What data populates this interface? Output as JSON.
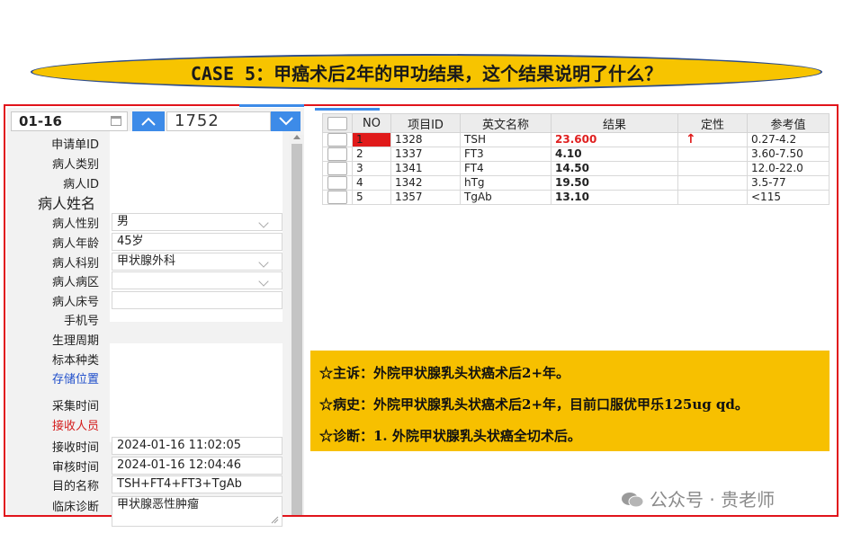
{
  "title": "CASE 5：甲癌术后2年的甲功结果，这个结果说明了什么？",
  "left": {
    "date": "01-16",
    "sample_no": "1752",
    "fields": [
      {
        "label": "申请单ID",
        "value": ""
      },
      {
        "label": "病人类别",
        "value": ""
      },
      {
        "label": "病人ID",
        "value": ""
      },
      {
        "label": "病人姓名",
        "value": ""
      },
      {
        "label": "病人性别",
        "value": "男"
      },
      {
        "label": "病人年龄",
        "value": "45岁"
      },
      {
        "label": "病人科别",
        "value": "甲状腺外科"
      },
      {
        "label": "病人病区",
        "value": ""
      },
      {
        "label": "病人床号",
        "value": ""
      },
      {
        "label": "手机号",
        "value": ""
      },
      {
        "label": "生理周期",
        "value": ""
      },
      {
        "label": "标本种类",
        "value": ""
      },
      {
        "label": "存储位置",
        "value": ""
      },
      {
        "label": "采集时间",
        "value": ""
      },
      {
        "label": "接收人员",
        "value": ""
      },
      {
        "label": "接收时间",
        "value": "2024-01-16 11:02:05"
      },
      {
        "label": "审核时间",
        "value": "2024-01-16 12:04:46"
      },
      {
        "label": "目的名称",
        "value": "TSH+FT4+FT3+TgAb"
      },
      {
        "label": "临床诊断",
        "value": "甲状腺恶性肿瘤"
      }
    ]
  },
  "table": {
    "headers": [
      "NO",
      "项目ID",
      "英文名称",
      "结果",
      "定性",
      "参考值"
    ],
    "rows": [
      {
        "no": "1",
        "id": "1328",
        "name": "TSH",
        "result": "23.600",
        "flag": "↑",
        "ref": "0.27-4.2"
      },
      {
        "no": "2",
        "id": "1337",
        "name": "FT3",
        "result": "4.10",
        "flag": "",
        "ref": "3.60-7.50"
      },
      {
        "no": "3",
        "id": "1341",
        "name": "FT4",
        "result": "14.50",
        "flag": "",
        "ref": "12.0-22.0"
      },
      {
        "no": "4",
        "id": "1342",
        "name": "hTg",
        "result": "19.50",
        "flag": "",
        "ref": "3.5-77"
      },
      {
        "no": "5",
        "id": "1357",
        "name": "TgAb",
        "result": "13.10",
        "flag": "",
        "ref": "<115"
      }
    ]
  },
  "notes": [
    "☆主诉：外院甲状腺乳头状癌术后2+年。",
    "☆病史：外院甲状腺乳头状癌术后2+年，目前口服优甲乐125ug qd。",
    "☆诊断：1. 外院甲状腺乳头状癌全切术后。"
  ],
  "watermark": "公众号 · 贵老师",
  "colors": {
    "accent": "#3d8be8",
    "frame": "#e1141b",
    "highlight": "#f7c000",
    "alert": "#e01a1a"
  }
}
